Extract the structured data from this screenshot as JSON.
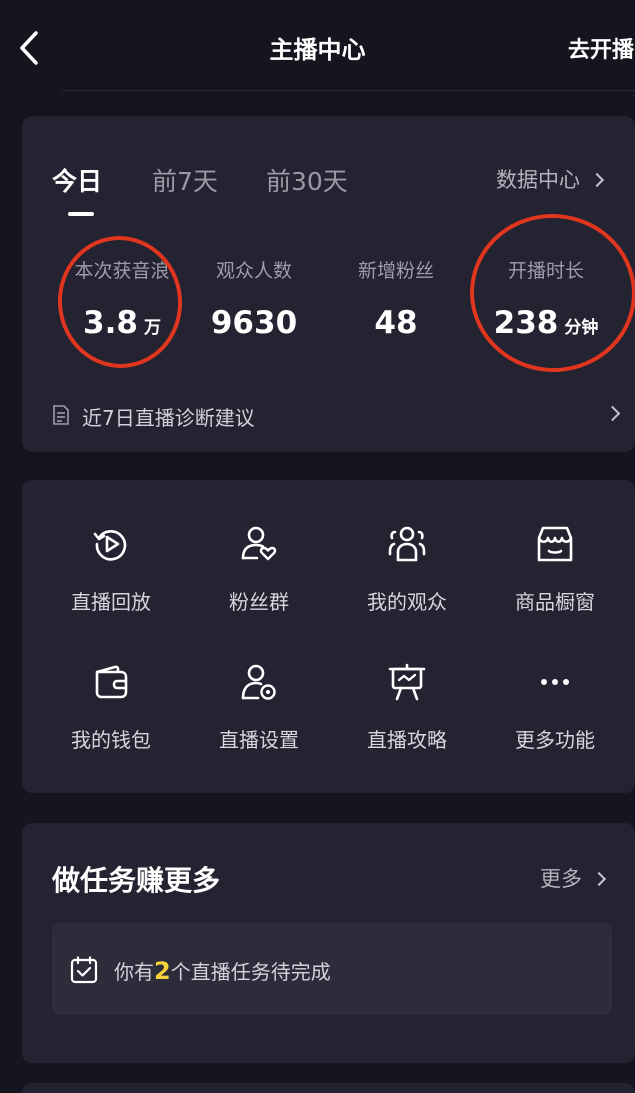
{
  "header": {
    "title": "主播中心",
    "go_live_label": "去开播"
  },
  "stats": {
    "tabs": [
      {
        "label": "今日",
        "active": true
      },
      {
        "label": "前7天",
        "active": false
      },
      {
        "label": "前30天",
        "active": false
      }
    ],
    "data_center_label": "数据中心",
    "items": [
      {
        "label": "本次获音浪",
        "value": "3.8",
        "unit": "万"
      },
      {
        "label": "观众人数",
        "value": "9630",
        "unit": ""
      },
      {
        "label": "新增粉丝",
        "value": "48",
        "unit": ""
      },
      {
        "label": "开播时长",
        "value": "238",
        "unit": "分钟"
      }
    ],
    "advice_label": "近7日直播诊断建议",
    "highlight_color": "#e0351f"
  },
  "tools": [
    {
      "label": "直播回放",
      "icon": "replay-icon"
    },
    {
      "label": "粉丝群",
      "icon": "fan-group-icon"
    },
    {
      "label": "我的观众",
      "icon": "audience-icon"
    },
    {
      "label": "商品橱窗",
      "icon": "shop-window-icon"
    },
    {
      "label": "我的钱包",
      "icon": "wallet-icon"
    },
    {
      "label": "直播设置",
      "icon": "live-settings-icon"
    },
    {
      "label": "直播攻略",
      "icon": "live-guide-icon"
    },
    {
      "label": "更多功能",
      "icon": "more-icon"
    }
  ],
  "tasks": {
    "title": "做任务赚更多",
    "more_label": "更多",
    "prefix": "你有",
    "count": "2",
    "suffix": "个直播任务待完成",
    "count_color": "#f5d13b"
  }
}
